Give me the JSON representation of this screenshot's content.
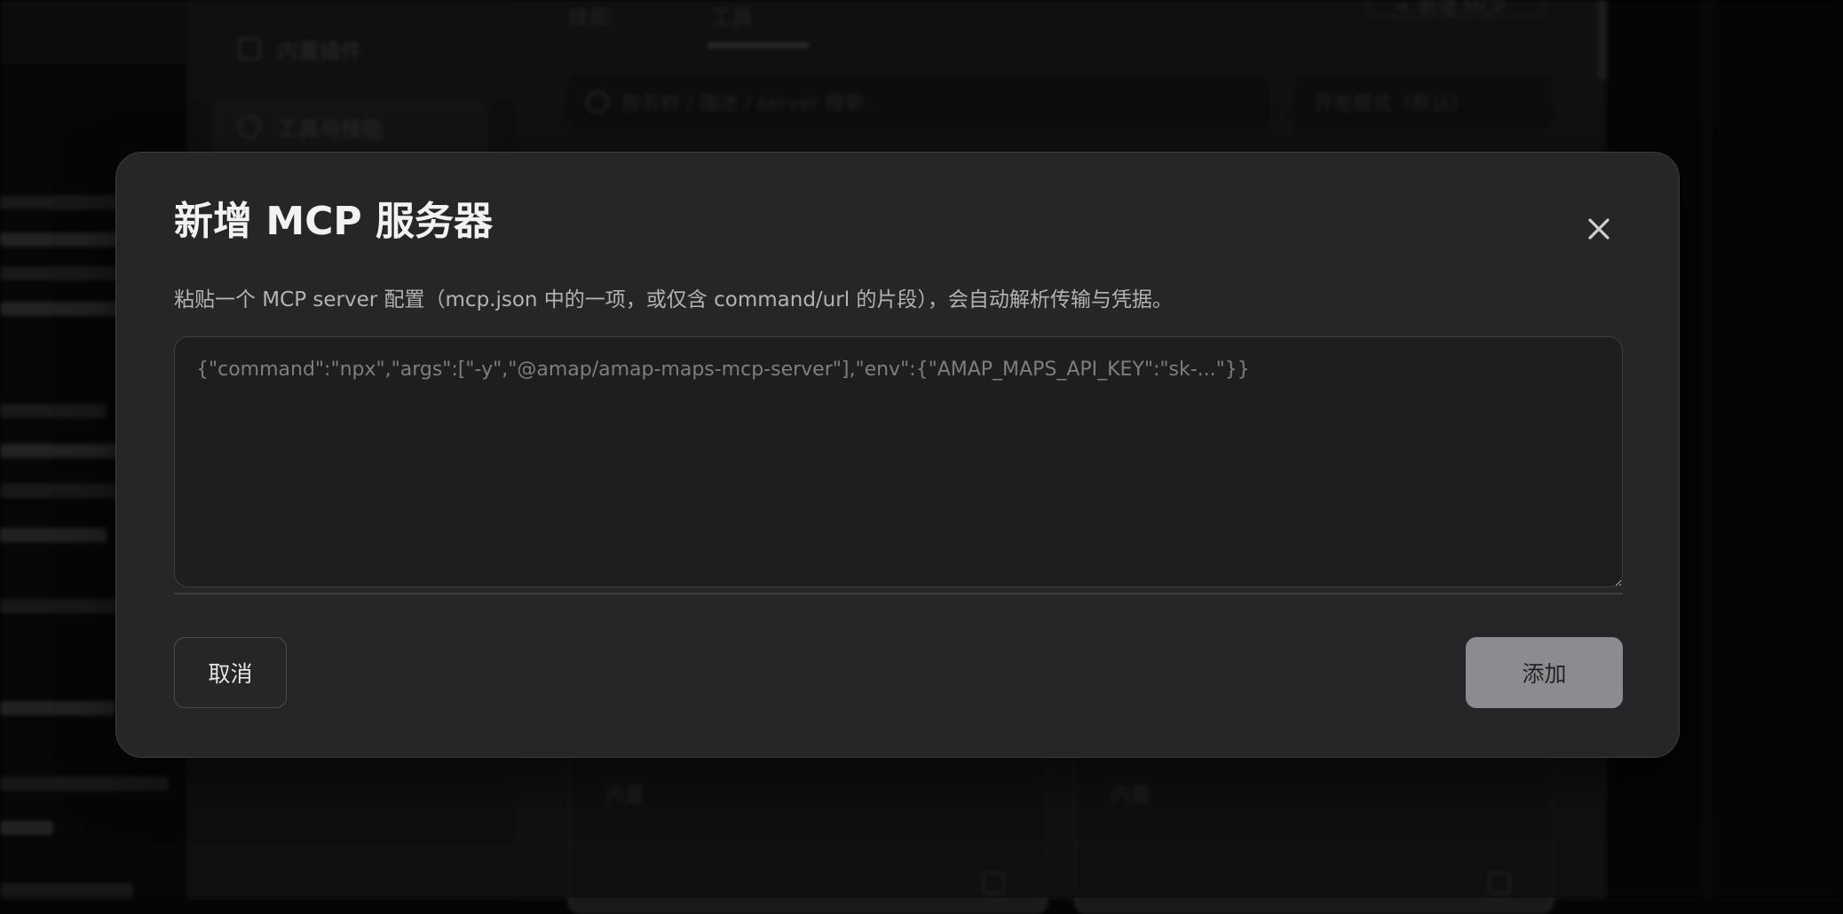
{
  "background": {
    "sidebar": {
      "items": [
        {
          "label": "内置插件"
        },
        {
          "label": "工具与技能"
        }
      ]
    },
    "tabs": [
      {
        "label": "技能"
      },
      {
        "label": "工具"
      }
    ],
    "add_mcp_label": "+ 新增 MCP",
    "search_placeholder": "按名称 / 描述 / server 搜索...",
    "mode_select": "开发模式（默认）",
    "cards": [
      {
        "tag": "内置"
      },
      {
        "tag": "内置"
      }
    ]
  },
  "modal": {
    "title": "新增 MCP 服务器",
    "description": "粘贴一个 MCP server 配置（mcp.json 中的一项，或仅含 command/url 的片段），会自动解析传输与凭据。",
    "config_input": {
      "value": "",
      "placeholder": "{\"command\":\"npx\",\"args\":[\"-y\",\"@amap/amap-maps-mcp-server\"],\"env\":{\"AMAP_MAPS_API_KEY\":\"sk-...\"}}"
    },
    "cancel_label": "取消",
    "add_label": "添加"
  },
  "colors": {
    "modal_bg": "#262628",
    "input_bg": "#1e1e20",
    "add_button_bg": "#8c8c90",
    "title_text": "#f2f2f3"
  },
  "icons": {
    "close": "close-icon",
    "search": "search-icon",
    "chevron": "chevron-down-icon"
  }
}
